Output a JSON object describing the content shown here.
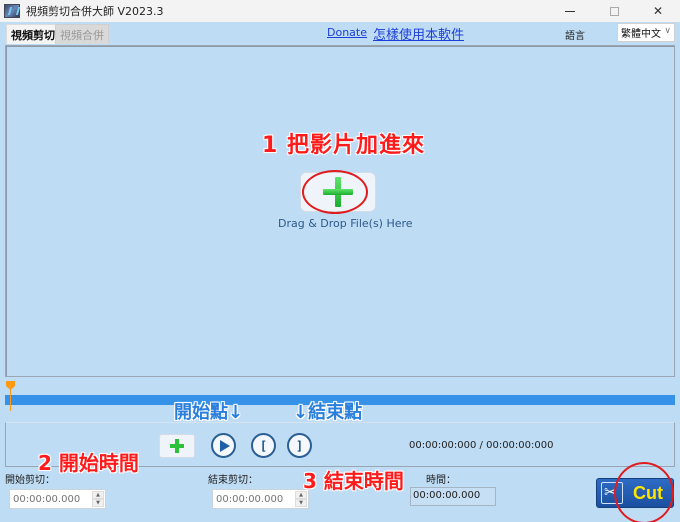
{
  "window": {
    "title": "視頻剪切合併大師 V2023.3",
    "controls": {
      "minimize": "—",
      "maximize": "□",
      "close": "✕"
    }
  },
  "tabs": [
    {
      "label": "視頻剪切",
      "active": true
    },
    {
      "label": "視頻合併",
      "active": false
    }
  ],
  "header": {
    "donate_link": "Donate",
    "howto_link": "怎樣使用本軟件",
    "language_label": "語言",
    "language_selected": "繁體中文"
  },
  "dropzone": {
    "annotation": "1  把影片加進來",
    "hint": "Drag & Drop File(s) Here",
    "add_icon": "plus-icon"
  },
  "timeline": {
    "position": 0,
    "annotation_start": "開始點↓",
    "annotation_end": "↓結束點"
  },
  "controls": {
    "add_icon": "plus-icon",
    "play_icon": "play-icon",
    "set_start_label": "[",
    "set_end_label": "]",
    "time_readout": "00:00:00:000 / 00:00:00:000"
  },
  "fields": {
    "annotation_start": "2  開始時間",
    "annotation_end": "3  結束時間",
    "start_label": "開始剪切：",
    "start_placeholder": "00:00:00.000",
    "end_label": "結束剪切：",
    "end_placeholder": "00:00:00.000",
    "duration_label": "時間：",
    "duration_value": "00:00:00.000"
  },
  "cut_button": {
    "label": "Cut",
    "icon": "scissors-film-icon"
  }
}
